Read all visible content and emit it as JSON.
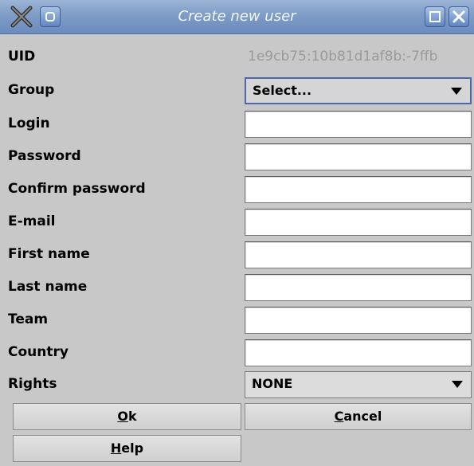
{
  "window": {
    "title": "Create new user",
    "controls": [
      "app-logo-icon",
      "menu-icon",
      "maximize-icon",
      "close-icon"
    ]
  },
  "form": {
    "uid": {
      "label": "UID",
      "value": "1e9cb75:10b81d1af8b:-7ffb"
    },
    "group": {
      "label": "Group",
      "selected": "Select..."
    },
    "login": {
      "label": "Login",
      "value": ""
    },
    "password": {
      "label": "Password",
      "value": ""
    },
    "confirm_password": {
      "label": "Confirm password",
      "value": ""
    },
    "email": {
      "label": "E-mail",
      "value": ""
    },
    "first_name": {
      "label": "First name",
      "value": ""
    },
    "last_name": {
      "label": "Last name",
      "value": ""
    },
    "team": {
      "label": "Team",
      "value": ""
    },
    "country": {
      "label": "Country",
      "value": ""
    },
    "rights": {
      "label": "Rights",
      "selected": "NONE"
    }
  },
  "buttons": {
    "ok": {
      "mnemonic": "O",
      "rest": "k"
    },
    "cancel": {
      "mnemonic": "C",
      "rest": "ancel"
    },
    "help": {
      "mnemonic": "H",
      "rest": "elp"
    }
  },
  "colors": {
    "titlebar": "#7e9cc6",
    "window_bg": "#c8c8c8",
    "focus_border": "#4c68a8"
  }
}
